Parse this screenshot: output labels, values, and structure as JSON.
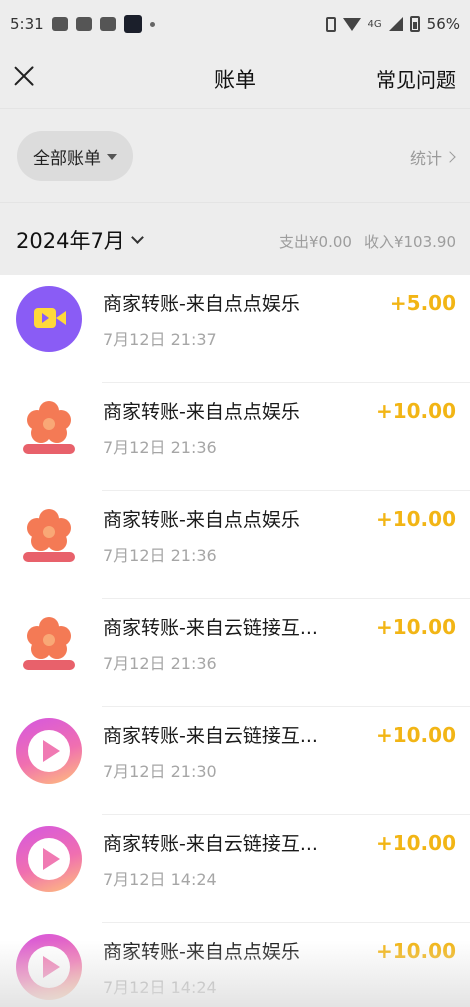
{
  "status_bar": {
    "time": "5:31",
    "network": "4G",
    "battery": "56%"
  },
  "nav": {
    "title": "账单",
    "faq": "常见问题"
  },
  "filter": {
    "label": "全部账单",
    "stats": "统计"
  },
  "month": {
    "label": "2024年7月",
    "expense": "支出¥0.00",
    "income": "收入¥103.90"
  },
  "transactions": [
    {
      "title": "商家转账-来自点点娱乐",
      "time": "7月12日 21:37",
      "amount": "+5.00",
      "icon": "video-camera-icon"
    },
    {
      "title": "商家转账-来自点点娱乐",
      "time": "7月12日 21:36",
      "amount": "+10.00",
      "icon": "flower-logo-icon"
    },
    {
      "title": "商家转账-来自点点娱乐",
      "time": "7月12日 21:36",
      "amount": "+10.00",
      "icon": "flower-logo-icon"
    },
    {
      "title": "商家转账-来自云链接互...",
      "time": "7月12日 21:36",
      "amount": "+10.00",
      "icon": "flower-logo-icon"
    },
    {
      "title": "商家转账-来自云链接互...",
      "time": "7月12日 21:30",
      "amount": "+10.00",
      "icon": "play-button-icon"
    },
    {
      "title": "商家转账-来自云链接互...",
      "time": "7月12日 14:24",
      "amount": "+10.00",
      "icon": "play-button-icon"
    },
    {
      "title": "商家转账-来自点点娱乐",
      "time": "7月12日 14:24",
      "amount": "+10.00",
      "icon": "play-button-icon"
    }
  ],
  "colors": {
    "amount": "#f2b515",
    "header_bg": "#ededed",
    "secondary_text": "#a6a6a6"
  }
}
